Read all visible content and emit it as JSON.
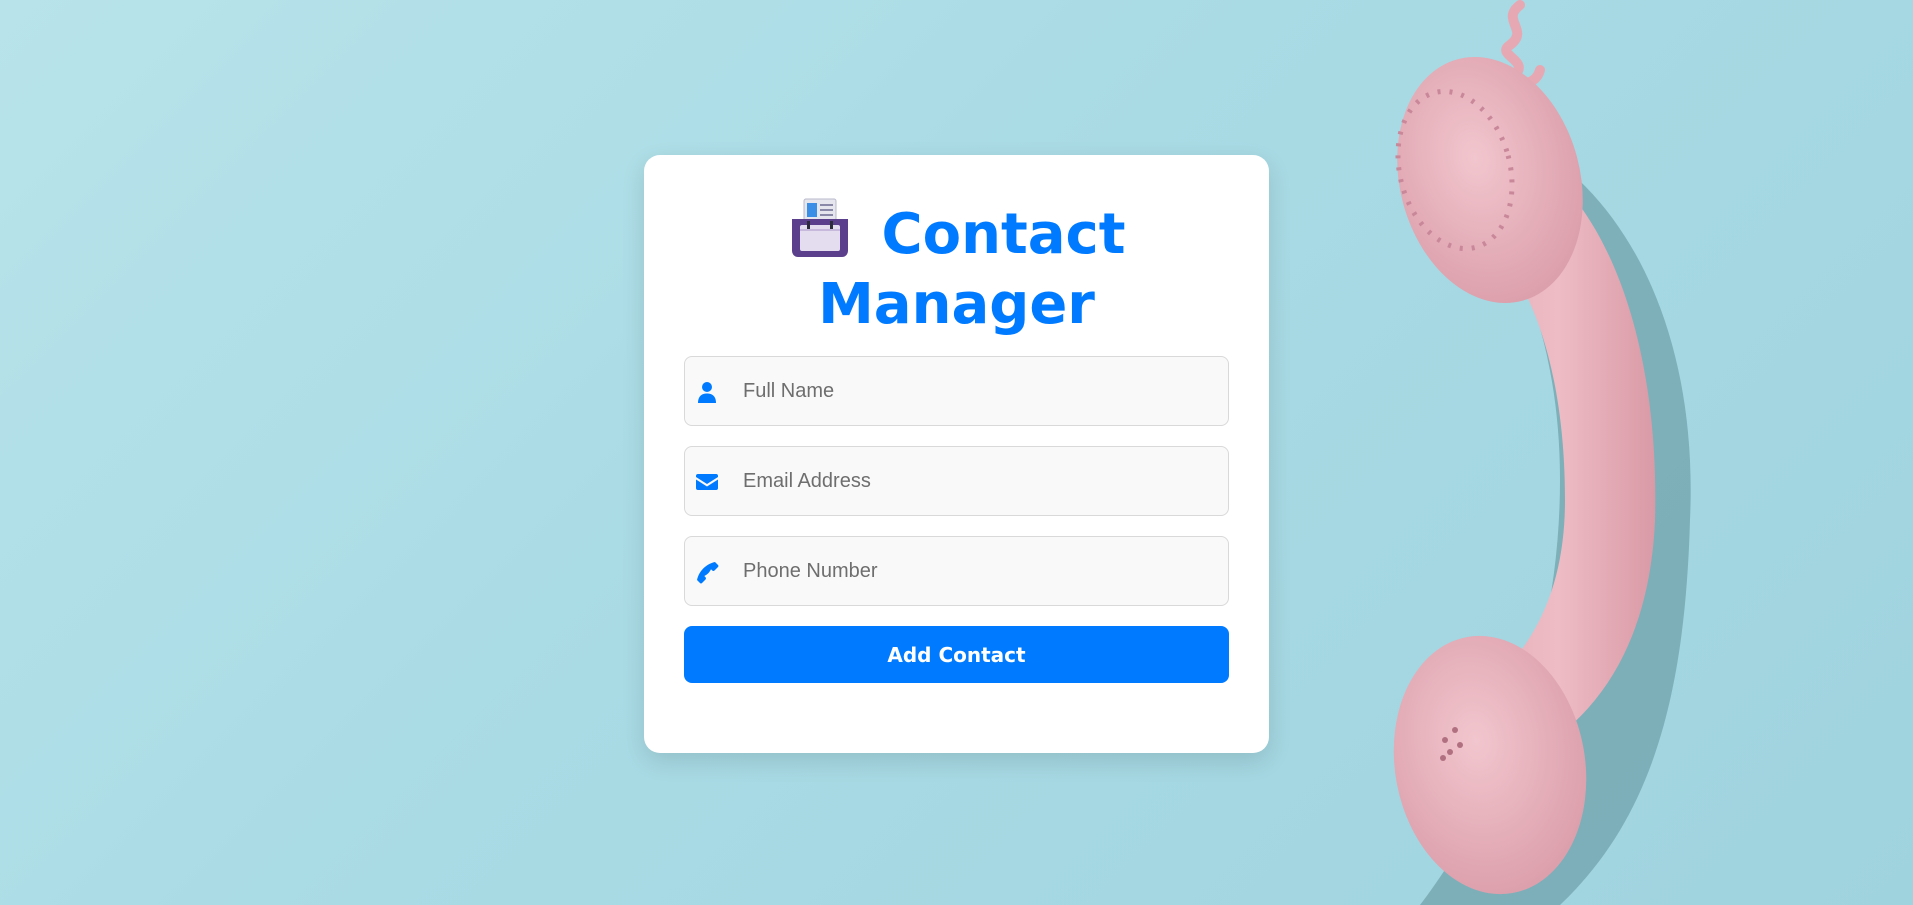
{
  "colors": {
    "accent": "#007bff",
    "background": "#a9dbe5",
    "card": "#ffffff",
    "phone": "#e8b4be"
  },
  "background_image": {
    "subject": "pink-telephone-handset"
  },
  "header": {
    "icon": "card-index-icon",
    "title_line1": "Contact",
    "title_line2": "Manager"
  },
  "form": {
    "name": {
      "icon": "user-icon",
      "placeholder": "Full Name",
      "value": ""
    },
    "email": {
      "icon": "envelope-icon",
      "placeholder": "Email Address",
      "value": ""
    },
    "phone": {
      "icon": "phone-icon",
      "placeholder": "Phone Number",
      "value": ""
    },
    "submit_label": "Add Contact"
  }
}
